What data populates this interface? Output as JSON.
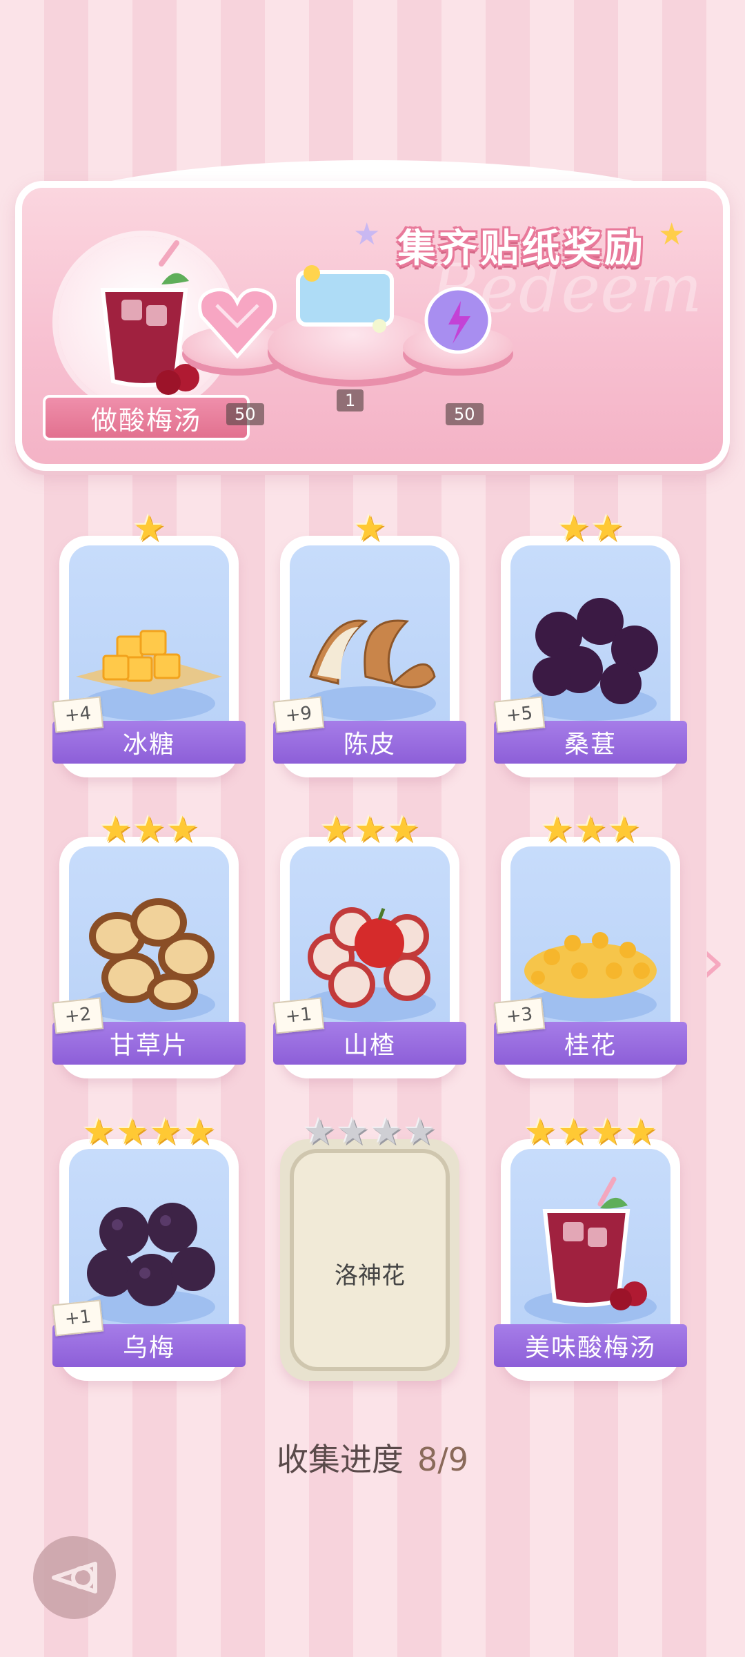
{
  "banner": {
    "title": "集齐贴纸奖励",
    "watermark": "Redeem",
    "recipe_label": "做酸梅汤",
    "rewards": [
      {
        "icon": "pink-heart-gem-icon",
        "count": "50"
      },
      {
        "icon": "blue-sticker-card-icon",
        "count": "1"
      },
      {
        "icon": "purple-energy-orb-icon",
        "count": "50"
      }
    ]
  },
  "cards": [
    {
      "name": "冰糖",
      "stars": 1,
      "plus": "+4",
      "icon": "rock-sugar-icon",
      "locked": false
    },
    {
      "name": "陈皮",
      "stars": 1,
      "plus": "+9",
      "icon": "dried-peel-icon",
      "locked": false
    },
    {
      "name": "桑葚",
      "stars": 2,
      "plus": "+5",
      "icon": "mulberry-icon",
      "locked": false
    },
    {
      "name": "甘草片",
      "stars": 3,
      "plus": "+2",
      "icon": "licorice-slices-icon",
      "locked": false
    },
    {
      "name": "山楂",
      "stars": 3,
      "plus": "+1",
      "icon": "hawthorn-icon",
      "locked": false
    },
    {
      "name": "桂花",
      "stars": 3,
      "plus": "+3",
      "icon": "osmanthus-icon",
      "locked": false
    },
    {
      "name": "乌梅",
      "stars": 4,
      "plus": "+1",
      "icon": "dark-plum-icon",
      "locked": false
    },
    {
      "name": "洛神花",
      "stars": 4,
      "plus": "",
      "icon": "",
      "locked": true
    },
    {
      "name": "美味酸梅汤",
      "stars": 4,
      "plus": "",
      "icon": "plum-drink-icon",
      "locked": false
    }
  ],
  "progress": {
    "label": "收集进度",
    "value": "8/9"
  },
  "colors": {
    "card_name_bg": "#9b6ee0",
    "star": "#ffc934",
    "banner_pink": "#f7bfd0"
  }
}
